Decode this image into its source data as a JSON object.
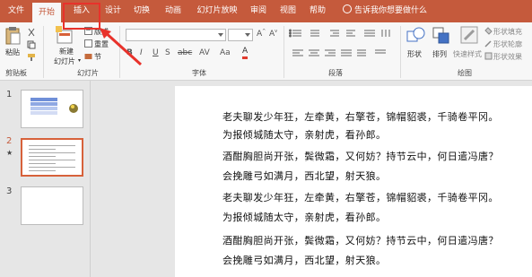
{
  "menu": {
    "tabs": [
      "文件",
      "开始",
      "插入",
      "设计",
      "切换",
      "动画",
      "幻灯片放映",
      "审阅",
      "视图",
      "帮助"
    ],
    "tell_me": "告诉我你想要做什么"
  },
  "ribbon": {
    "clipboard": {
      "paste": "粘贴",
      "group": "剪贴板"
    },
    "slides": {
      "new_slide": "新建",
      "new_slide2": "幻灯片",
      "layout": "版式",
      "reset": "重置",
      "section": "节",
      "group": "幻灯片"
    },
    "font": {
      "group": "字体",
      "bold": "B",
      "italic": "I",
      "underline": "U",
      "strike": "S",
      "shadow": "abc",
      "aa": "AV",
      "case": "Aa",
      "color": "A"
    },
    "paragraph": {
      "group": "段落"
    },
    "drawing": {
      "shapes": "形状",
      "arrange": "排列",
      "quick_styles": "快速样式",
      "fill": "形状填充",
      "outline": "形状轮廓",
      "effects": "形状效果",
      "group": "绘图"
    }
  },
  "thumbnails": [
    {
      "number": "1"
    },
    {
      "number": "2",
      "marker": "★"
    },
    {
      "number": "3"
    }
  ],
  "slide": {
    "lines": [
      "老夫聊发少年狂，左牵黄，右擎苍，锦帽貂裘，千骑卷平冈。",
      "为报倾城随太守，亲射虎，看孙郎。",
      "酒酣胸胆尚开张，鬓微霜，又何妨？持节云中，何日遣冯唐？",
      "会挽雕弓如满月，西北望，射天狼。",
      "老夫聊发少年狂，左牵黄，右擎苍，锦帽貂裘，千骑卷平冈。",
      "为报倾城随太守，亲射虎，看孙郎。",
      "酒酣胸胆尚开张，鬓微霜，又何妨？持节云中，何日遣冯唐？",
      "会挽雕弓如满月，西北望，射天狼。"
    ]
  },
  "colors": {
    "accent": "#c55a3c",
    "highlight": "#e8322b"
  }
}
